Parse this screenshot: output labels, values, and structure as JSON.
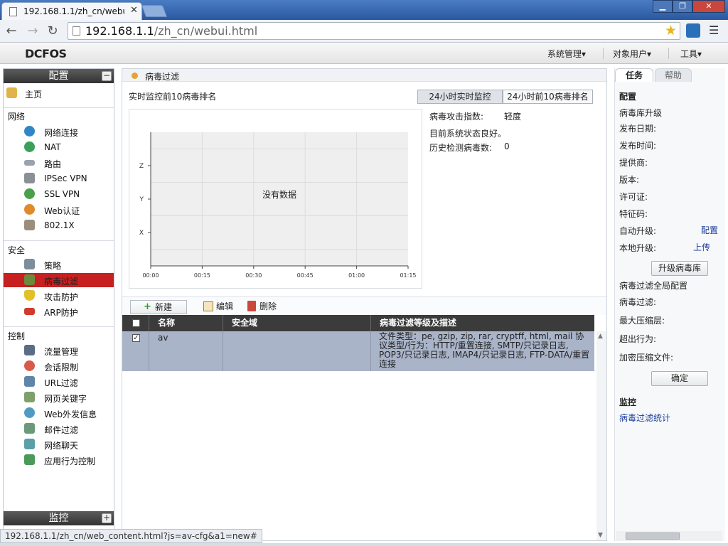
{
  "browser": {
    "tab_title": "192.168.1.1/zh_cn/webu",
    "url_host": "192.168.1.1",
    "url_path": "/zh_cn/webui.html",
    "status_text": "192.168.1.1/zh_cn/web_content.html?js=av-cfg&a1=new#"
  },
  "header": {
    "logo": "DCFOS",
    "menus": [
      "系统管理▾",
      "对象用户▾",
      "工具▾"
    ]
  },
  "sidebar": {
    "config_title": "配置",
    "collapse_symbol": "−",
    "home_label": "主页",
    "sections": {
      "network": {
        "title": "网络",
        "items": [
          "网络连接",
          "NAT",
          "路由",
          "IPSec VPN",
          "SSL VPN",
          "Web认证",
          "802.1X"
        ]
      },
      "security": {
        "title": "安全",
        "items": [
          "策略",
          "病毒过滤",
          "攻击防护",
          "ARP防护"
        ]
      },
      "control": {
        "title": "控制",
        "items": [
          "流量管理",
          "会话限制",
          "URL过滤",
          "网页关键字",
          "Web外发信息",
          "邮件过滤",
          "网络聊天",
          "应用行为控制"
        ]
      }
    },
    "monitor_title": "监控",
    "expand_symbol": "+"
  },
  "content": {
    "breadcrumb": "病毒过滤",
    "monitor_title": "实时监控前10病毒排名",
    "btn_24h_live": "24小时实时监控",
    "btn_24h_rank": "24小时前10病毒排名",
    "stats": {
      "attack_index_label": "病毒攻击指数:",
      "attack_index_value": "轻度",
      "system_status": "目前系统状态良好。",
      "history_label": "历史检测病毒数:",
      "history_value": "0"
    },
    "actions": {
      "new": "新建",
      "edit": "编辑",
      "delete": "删除"
    },
    "table": {
      "headers": [
        "名称",
        "安全域",
        "病毒过滤等级及描述"
      ],
      "rows": [
        {
          "checked": true,
          "name": "av",
          "zone": "",
          "desc": "文件类型：pe, gzip, zip, rar, cryptff, html, mail 协议类型/行为：HTTP/重置连接, SMTP/只记录日志, POP3/只记录日志, IMAP4/只记录日志, FTP-DATA/重置连接"
        }
      ]
    }
  },
  "chart_data": {
    "type": "line",
    "title": "",
    "empty_message": "没有数据",
    "categories": [
      "X",
      "Y",
      "Z"
    ],
    "x": [
      "00:00",
      "00:15",
      "00:30",
      "00:45",
      "01:00",
      "01:15"
    ],
    "series": [],
    "grid": true
  },
  "right_panel": {
    "tab_task": "任务",
    "tab_help": "帮助",
    "config_heading": "配置",
    "fields": [
      "病毒库升级",
      "发布日期:",
      "发布时间:",
      "提供商:",
      "版本:",
      "许可证:",
      "特征码:"
    ],
    "auto_upgrade_label": "自动升级:",
    "auto_upgrade_link": "配置",
    "local_upgrade_label": "本地升级:",
    "local_upgrade_link": "上传",
    "upgrade_button": "升级病毒库",
    "global_fields": [
      "病毒过滤全局配置",
      "病毒过滤:",
      "最大压缩层:",
      "超出行为:",
      "加密压缩文件:"
    ],
    "ok_button": "确定",
    "monitor_heading": "监控",
    "monitor_link": "病毒过滤统计"
  }
}
